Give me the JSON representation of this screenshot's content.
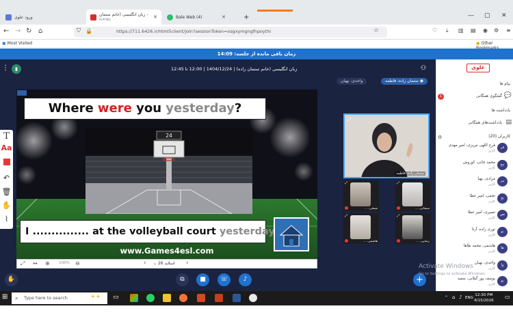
{
  "browser": {
    "tabs": [
      {
        "label": "ورود علوی",
        "active": false
      },
      {
        "label": "علوی - زبان انگلیسی (خانم ستمان...",
        "sub": "PLAYING",
        "active": true
      },
      {
        "label": "Bale Web (4)",
        "active": false
      }
    ],
    "new_tab": "+",
    "url": "https://711.6426.ir/html5client/join?sessionToken=osgxymgngfhpoythi",
    "bookmarks_left": "Most Visited",
    "bookmarks_right": "Other Bookmarks"
  },
  "banner": {
    "text": "زمان باقی مانده از جلسه: 14:09"
  },
  "meeting": {
    "title": "زبان انگلیسی (خانم ستمان زاده) | 1404/12/24 | 12:00 تا 12:45",
    "presenter_chip": "ستمان زاده، فاطمه",
    "talking_chip": "واحدی، بهیان"
  },
  "slide": {
    "title_parts": {
      "a": "Where ",
      "b": "were",
      "c": " you ",
      "d": "yesterday",
      "e": "?"
    },
    "scoreboard": "24",
    "sentence_parts": {
      "a": "I ............... at the volleyball court ",
      "b": "yesterday",
      "c": "."
    },
    "url": "www.Games4esl.com",
    "nav_label": "اسلاید 26",
    "zoom": "100%"
  },
  "video": {
    "main_name": "ستمان زاده، فاطمه",
    "tiles": [
      {
        "name": "شیخی، ..."
      },
      {
        "name": "سبحانی، ..."
      },
      {
        "name": "هاشمی، ..."
      },
      {
        "name": "رضایی، ..."
      }
    ]
  },
  "sidebar": {
    "logo": "علوی",
    "messages_header": "پیام ها",
    "public_chat": "گفتگوی همگانی",
    "public_chat_badge": "1",
    "notes_header": "یادداشت ها",
    "shared_notes": "یادداشت‌های همگانی",
    "users_header": "کاربران (20)",
    "users": [
      {
        "name": "فرج اللهی تبریزی، امیر مهدی",
        "role": "کاربر",
        "av": "فر"
      },
      {
        "name": "محمد جانی، کوروش",
        "role": "کاربر",
        "av": "مح"
      },
      {
        "name": "مرادی، بهیا",
        "role": "کاربر",
        "av": "مر"
      },
      {
        "name": "نجمی، امیر عطا",
        "role": "کاربر",
        "av": "نج"
      },
      {
        "name": "نصیری، امیر عطا",
        "role": "کاربر",
        "av": "نص"
      },
      {
        "name": "نوری زاده، آرتا",
        "role": "کاربر",
        "av": "نو"
      },
      {
        "name": "هاشمی، محمد طاها",
        "role": "کاربر",
        "av": "ها"
      },
      {
        "name": "واحدی، بهیان",
        "role": "کاربر",
        "av": "وا"
      },
      {
        "name": "یوسف پور گیلانی، سعید",
        "role": "کاربر",
        "av": "یو"
      }
    ]
  },
  "os": {
    "watermark_title": "Activate Windows",
    "watermark_sub": "Go to Settings to activate Windows.",
    "search_placeholder": "Type here to search",
    "lang": "ENG",
    "time": "12:30 PM",
    "date": "4/15/2026"
  },
  "colors": {
    "accent": "#1f72ce",
    "app_bg": "#1a2340",
    "chip": "#2c5fa8",
    "red": "#d32f2f"
  }
}
